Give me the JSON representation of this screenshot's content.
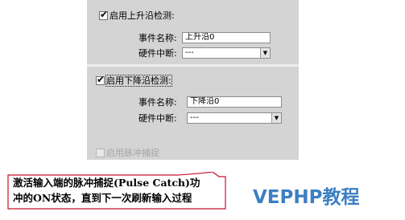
{
  "dialog": {
    "rising_edge": {
      "checkbox_label": "启用上升沿检测:",
      "checked": true,
      "event_name_label": "事件名称:",
      "event_name_value": "上升沿0",
      "hw_interrupt_label": "硬件中断:",
      "hw_interrupt_value": "---"
    },
    "falling_edge": {
      "checkbox_label": "启用下降沿检测:",
      "checked": true,
      "event_name_label": "事件名称:",
      "event_name_value": "下降沿0",
      "hw_interrupt_label": "硬件中断:",
      "hw_interrupt_value": "---"
    },
    "pulse_catch": {
      "checkbox_label": "启用脉冲捕捉",
      "checked": false,
      "enabled": false
    }
  },
  "annotation": {
    "line1": "激活输入端的脉冲捕捉(Pulse Catch)功",
    "line2": "冲的ON状态，直到下一次刷新输入过程"
  },
  "watermark": "VEPHP教程",
  "colors": {
    "panel": "#d4d4d4",
    "watermark": "#3c7fc2",
    "callout_border": "#c8102e"
  }
}
